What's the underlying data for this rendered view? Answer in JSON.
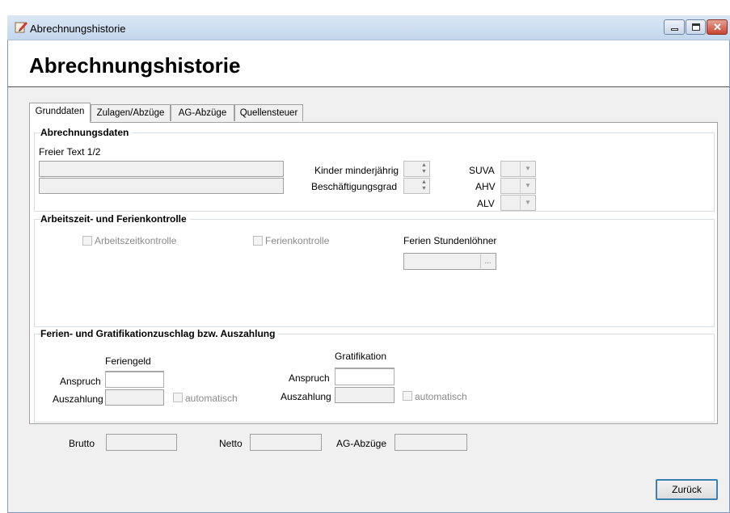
{
  "window": {
    "title": "Abrechnungshistorie",
    "icon": "app-edit-icon",
    "controls": [
      "minimize-icon",
      "maximize-icon",
      "close-icon"
    ]
  },
  "header": {
    "title": "Abrechnungshistorie"
  },
  "tabs": [
    {
      "label": "Grunddaten",
      "active": true
    },
    {
      "label": "Zulagen/Abzüge",
      "active": false
    },
    {
      "label": "AG-Abzüge",
      "active": false
    },
    {
      "label": "Quellensteuer",
      "active": false
    }
  ],
  "abrechnungsdaten": {
    "title": "Abrechnungsdaten",
    "freier_text_label": "Freier Text 1/2",
    "freier_text_1": "",
    "freier_text_2": "",
    "kinder_label": "Kinder minderjährig",
    "kinder_value": "",
    "beschaeftigungsgrad_label": "Beschäftigungsgrad",
    "beschaeftigungsgrad_value": "",
    "suva_label": "SUVA",
    "ahv_label": "AHV",
    "alv_label": "ALV",
    "suva_value": "",
    "ahv_value": "",
    "alv_value": ""
  },
  "arbeitszeit": {
    "title": "Arbeitszeit- und Ferienkontrolle",
    "arbeitszeitkontrolle_label": "Arbeitszeitkontrolle",
    "arbeitszeitkontrolle_checked": false,
    "ferienkontrolle_label": "Ferienkontrolle",
    "ferienkontrolle_checked": false,
    "ferien_stundenloehner_label": "Ferien Stundenlöhner",
    "ferien_stundenloehner_value": "",
    "ellipsis": "..."
  },
  "zuschlag": {
    "title": "Ferien- und Gratifikationzuschlag bzw. Auszahlung",
    "feriengeld_header": "Feriengeld",
    "gratifikation_header": "Gratifikation",
    "anspruch_label": "Anspruch",
    "auszahlung_label": "Auszahlung",
    "automatisch_label": "automatisch",
    "feriengeld_anspruch": "",
    "feriengeld_auszahlung": "",
    "gratifikation_anspruch": "",
    "gratifikation_auszahlung": ""
  },
  "totals": {
    "brutto_label": "Brutto",
    "netto_label": "Netto",
    "ag_abzuege_label": "AG-Abzüge",
    "brutto_value": "",
    "netto_value": "",
    "ag_abzuege_value": ""
  },
  "footer": {
    "back_button": "Zurück"
  }
}
